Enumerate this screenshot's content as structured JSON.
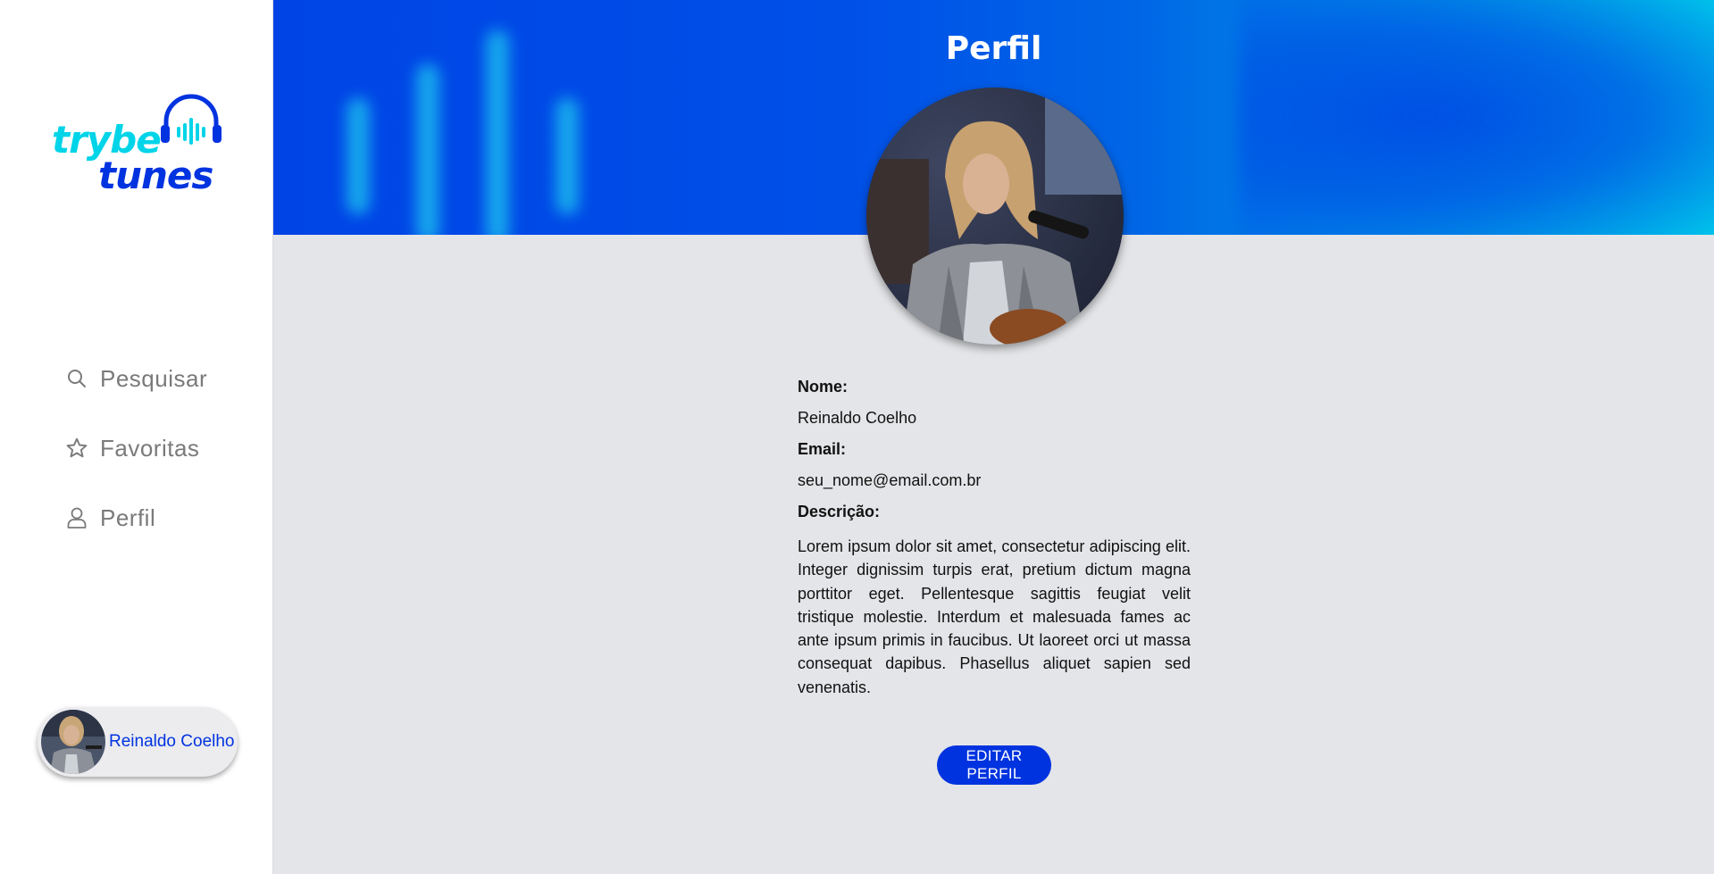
{
  "logo": {
    "line1": "trybe",
    "line2": "tunes"
  },
  "nav": {
    "items": [
      {
        "label": "Pesquisar",
        "icon": "search-icon"
      },
      {
        "label": "Favoritas",
        "icon": "star-icon"
      },
      {
        "label": "Perfil",
        "icon": "user-icon"
      }
    ]
  },
  "user": {
    "name": "Reinaldo Coelho"
  },
  "page": {
    "title": "Perfil"
  },
  "profile": {
    "name_label": "Nome:",
    "name": "Reinaldo Coelho",
    "email_label": "Email:",
    "email": "seu_nome@email.com.br",
    "description_label": "Descrição:",
    "description": "Lorem ipsum dolor sit amet, consectetur adipiscing elit. Integer dignissim turpis erat, pretium dictum magna porttitor eget. Pellentesque sagittis feugiat velit tristique molestie. Interdum et malesuada fames ac ante ipsum primis in faucibus. Ut laoreet orci ut massa consequat dapibus. Phasellus aliquet sapien sed venenatis.",
    "edit_button": "EDITAR PERFIL"
  },
  "colors": {
    "brand_blue": "#0033e0",
    "brand_cyan": "#00d4e8",
    "background": "#e4e5e8"
  }
}
